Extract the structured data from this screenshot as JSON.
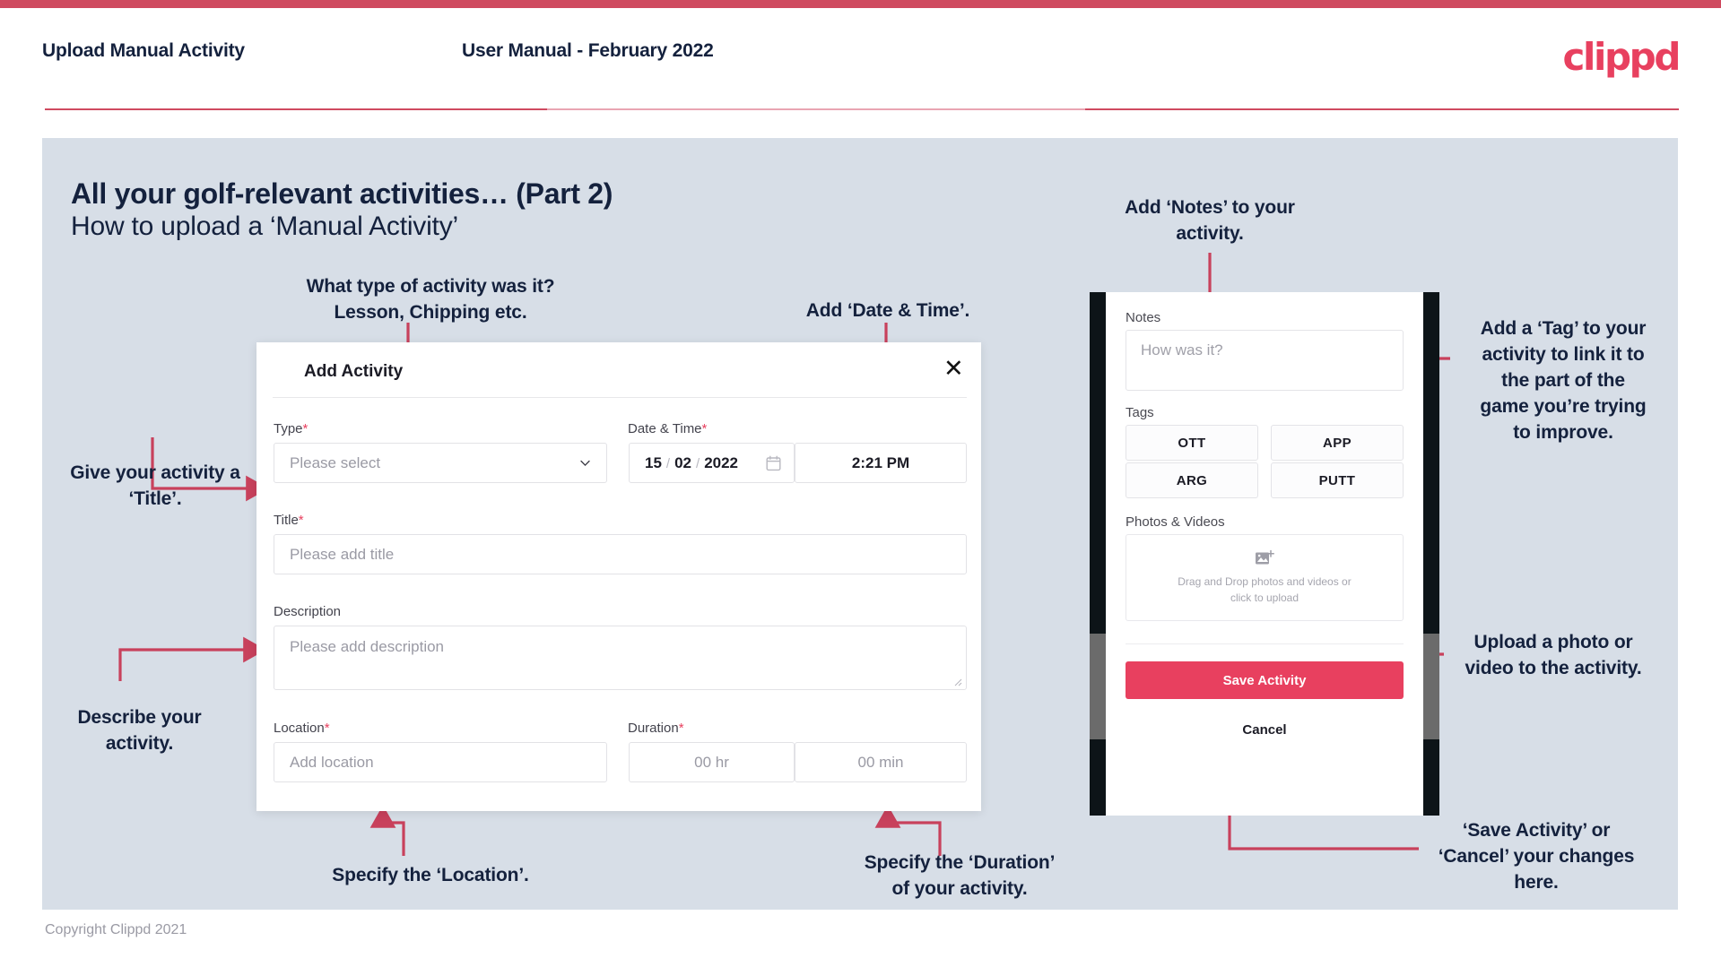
{
  "header": {
    "left_title": "Upload Manual Activity",
    "center_title": "User Manual - February 2022",
    "logo": "clippd"
  },
  "slide": {
    "title_main": "All your golf-relevant activities… (Part 2)",
    "title_sub": "How to upload a ‘Manual Activity’"
  },
  "annotations": {
    "type_note": "What type of activity was it?\nLesson, Chipping etc.",
    "datetime_note": "Add ‘Date & Time’.",
    "notes_note": "Add ‘Notes’ to your\nactivity.",
    "tag_note": "Add a ‘Tag’ to your\nactivity to link it to\nthe part of the\ngame you’re trying\nto improve.",
    "title_note": "Give your activity a\n‘Title’.",
    "description_note": "Describe your\nactivity.",
    "location_note": "Specify the ‘Location’.",
    "duration_note": "Specify the ‘Duration’\nof your activity.",
    "upload_note": "Upload a photo or\nvideo to the activity.",
    "save_note": "‘Save Activity’ or\n‘Cancel’ your changes\nhere."
  },
  "dialog": {
    "title": "Add Activity",
    "close_label": "✕",
    "fields": {
      "type": {
        "label": "Type",
        "required": "*",
        "placeholder": "Please select"
      },
      "datetime": {
        "label": "Date & Time",
        "required": "*",
        "day": "15",
        "month": "02",
        "year": "2022",
        "sep": "/",
        "time": "2:21 PM"
      },
      "title": {
        "label": "Title",
        "required": "*",
        "placeholder": "Please add title"
      },
      "description": {
        "label": "Description",
        "required": "",
        "placeholder": "Please add description"
      },
      "location": {
        "label": "Location",
        "required": "*",
        "placeholder": "Add location"
      },
      "duration": {
        "label": "Duration",
        "required": "*",
        "hours": "00 hr",
        "minutes": "00 min"
      }
    }
  },
  "phone": {
    "notes": {
      "label": "Notes",
      "placeholder": "How was it?"
    },
    "tags": {
      "label": "Tags",
      "items": [
        "OTT",
        "APP",
        "ARG",
        "PUTT"
      ]
    },
    "photos": {
      "label": "Photos & Videos",
      "dropzone_line1": "Drag and Drop photos and videos or",
      "dropzone_line2": "click to upload"
    },
    "save_label": "Save Activity",
    "cancel_label": "Cancel"
  },
  "footer": {
    "copyright": "Copyright Clippd 2021"
  },
  "colors": {
    "accent": "#e8405f",
    "rule": "#cf4a60",
    "slide_bg": "#d7dee7",
    "text_dark": "#14213d",
    "arrow": "#c8415c"
  }
}
